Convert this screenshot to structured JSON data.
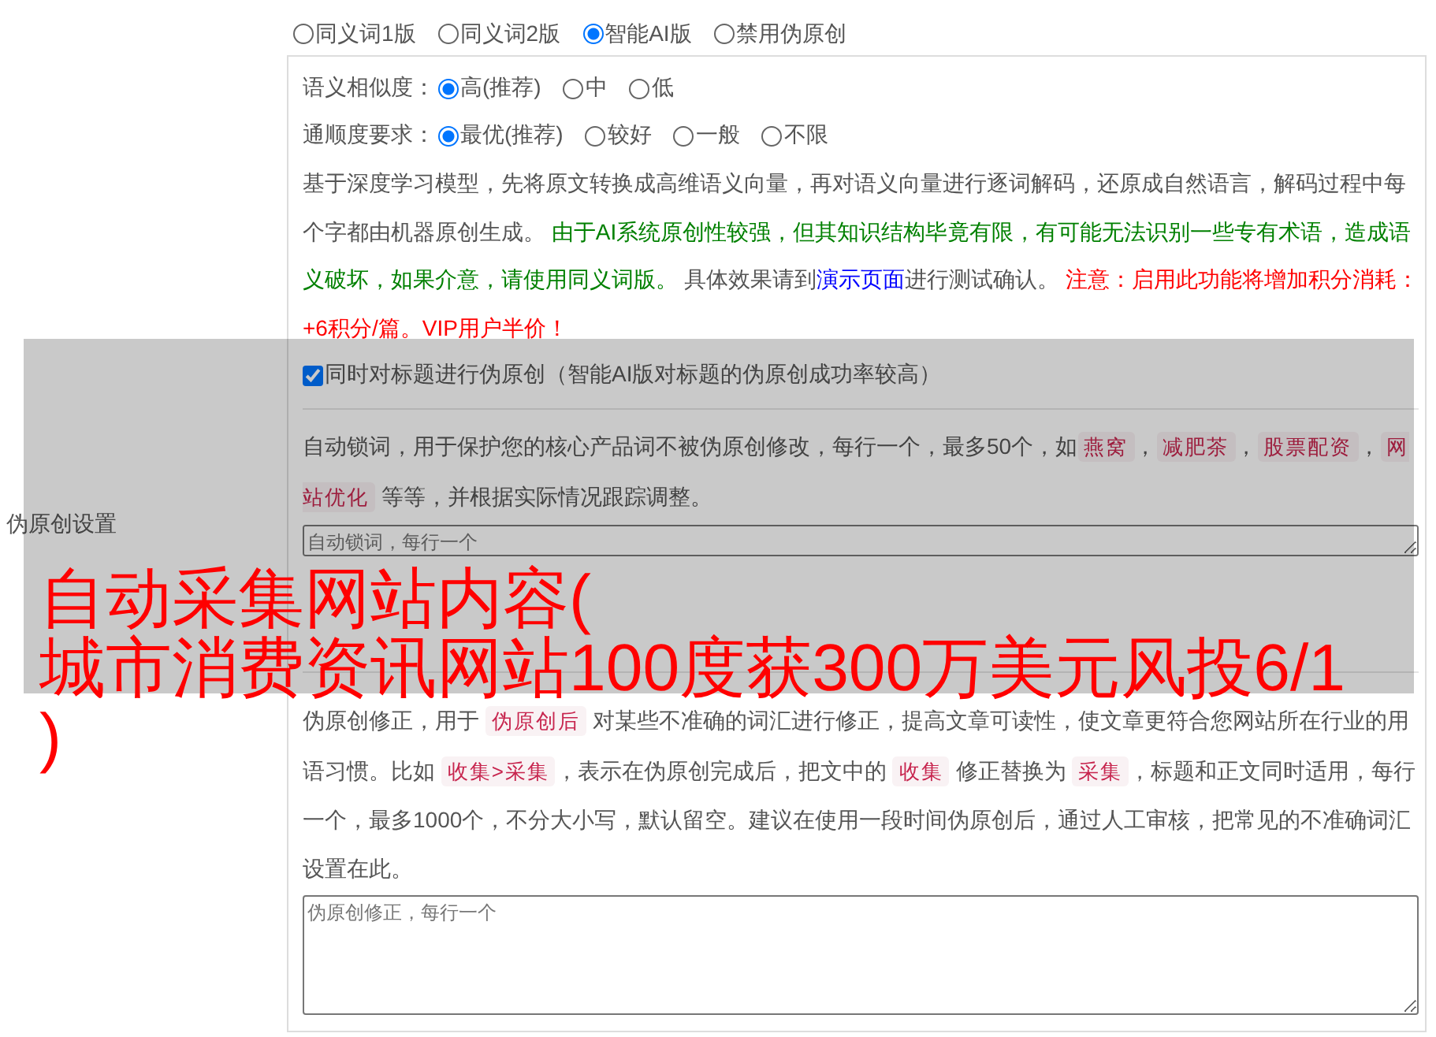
{
  "section_label": "伪原创设置",
  "mode_options": [
    {
      "label": "同义词1版",
      "selected": false
    },
    {
      "label": "同义词2版",
      "selected": false
    },
    {
      "label": "智能AI版",
      "selected": true
    },
    {
      "label": "禁用伪原创",
      "selected": false
    }
  ],
  "similarity": {
    "label": "语义相似度：",
    "options": [
      {
        "label": "高(推荐)",
        "selected": true
      },
      {
        "label": "中",
        "selected": false
      },
      {
        "label": "低",
        "selected": false
      }
    ]
  },
  "fluency": {
    "label": "通顺度要求：",
    "options": [
      {
        "label": "最优(推荐)",
        "selected": true
      },
      {
        "label": "较好",
        "selected": false
      },
      {
        "label": "一般",
        "selected": false
      },
      {
        "label": "不限",
        "selected": false
      }
    ]
  },
  "description": [
    {
      "kind": "text",
      "text": "基于深度学习模型，先将原文转换成高维语义向量，再对语义向量进行逐词解码，还原成自然语言，解码过程中每个字都由机器原创生成。 "
    },
    {
      "kind": "notice",
      "text": "由于AI系统原创性较强，但其知识结构毕竟有限，有可能无法识别一些专有术语，造成语义破坏，如果介意，请使用同义词版。"
    },
    {
      "kind": "text",
      "text": " 具体效果请到"
    },
    {
      "kind": "link",
      "text": "演示页面"
    },
    {
      "kind": "text",
      "text": "进行测试确认。 "
    },
    {
      "kind": "warning",
      "text": "注意：启用此功能将增加积分消耗：+6积分/篇。VIP用户半价！"
    }
  ],
  "title_checkbox": {
    "label": "同时对标题进行伪原创（智能AI版对标题的伪原创成功率较高）",
    "checked": true
  },
  "lock_words": {
    "description": [
      {
        "kind": "text",
        "text": "自动锁词，用于保护您的核心产品词不被伪原创修改，每行一个，最多50个，如"
      },
      {
        "kind": "code",
        "text": "燕窝"
      },
      {
        "kind": "text",
        "text": "，"
      },
      {
        "kind": "code",
        "text": "减肥茶"
      },
      {
        "kind": "text",
        "text": "，"
      },
      {
        "kind": "code",
        "text": "股票配资"
      },
      {
        "kind": "text",
        "text": "，"
      },
      {
        "kind": "code",
        "text": "网站优化"
      },
      {
        "kind": "text",
        "text": " 等等，并根据实际情况跟踪调整。"
      }
    ],
    "placeholder": "自动锁词，每行一个"
  },
  "correction": {
    "description": [
      {
        "kind": "text",
        "text": "伪原创修正，用于 "
      },
      {
        "kind": "code",
        "text": "伪原创后"
      },
      {
        "kind": "text",
        "text": " 对某些不准确的词汇进行修正，提高文章可读性，使文章更符合您网站所在行业的用语习惯。比如 "
      },
      {
        "kind": "code",
        "text": "收集>采集"
      },
      {
        "kind": "text",
        "text": "，表示在伪原创完成后，把文中的 "
      },
      {
        "kind": "code",
        "text": "收集"
      },
      {
        "kind": "text",
        "text": " 修正替换为 "
      },
      {
        "kind": "code",
        "text": "采集"
      },
      {
        "kind": "text",
        "text": "，标题和正文同时适用，每行一个，最多1000个，不分大小写，默认留空。建议在使用一段时间伪原创后，通过人工审核，把常见的不准确词汇设置在此。"
      }
    ],
    "placeholder": "伪原创修正，每行一个"
  },
  "headline_lines": [
    "自动采集网站内容(",
    "城市消费资讯网站100度获300万美元风投6/1",
    ")"
  ]
}
